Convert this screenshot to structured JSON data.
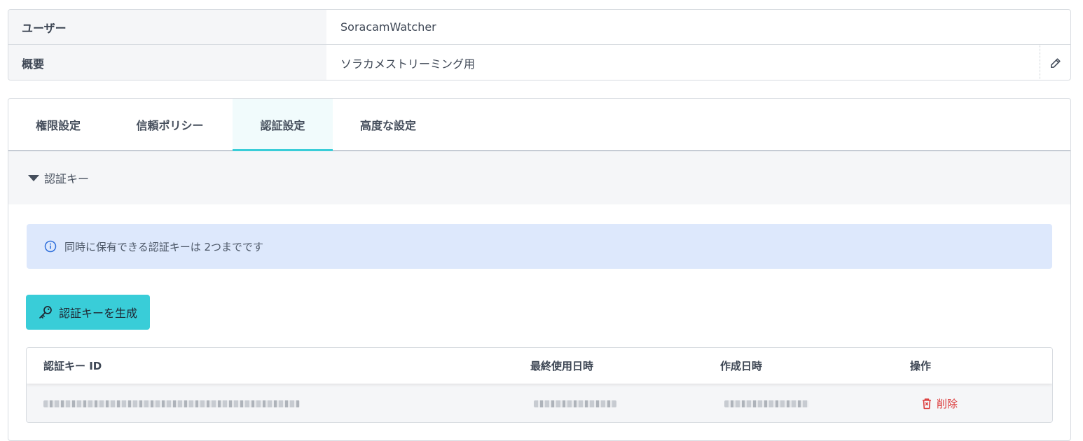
{
  "info": {
    "user_label": "ユーザー",
    "user_value": "SoracamWatcher",
    "summary_label": "概要",
    "summary_value": "ソラカメストリーミング用"
  },
  "tabs": [
    {
      "label": "権限設定",
      "active": false
    },
    {
      "label": "信頼ポリシー",
      "active": false
    },
    {
      "label": "認証設定",
      "active": true
    },
    {
      "label": "高度な設定",
      "active": false
    }
  ],
  "section": {
    "title": "認証キー",
    "notice": "同時に保有できる認証キーは 2つまでです",
    "generate_label": "認証キーを生成"
  },
  "table": {
    "headers": [
      "認証キー ID",
      "最終使用日時",
      "作成日時",
      "操作"
    ],
    "rows": [
      {
        "delete_label": "削除"
      }
    ]
  },
  "colors": {
    "accent": "#39cdd8",
    "notice_bg": "#dde8fc",
    "danger": "#dc3c3c"
  },
  "icons": [
    "pencil-icon",
    "caret-down-icon",
    "info-icon",
    "key-icon",
    "trash-icon"
  ]
}
